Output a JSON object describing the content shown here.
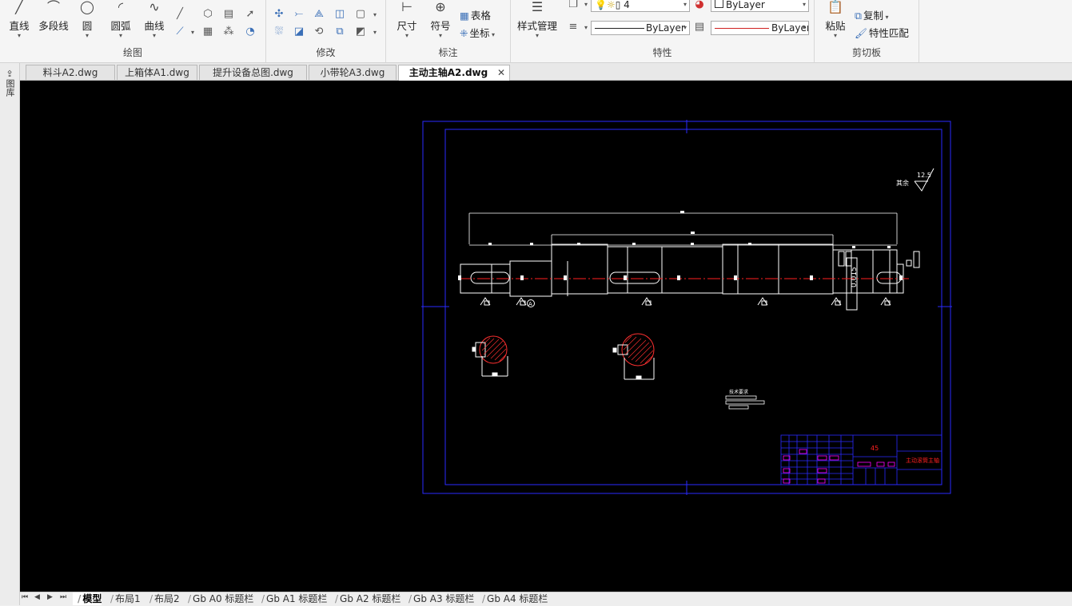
{
  "ribbon": {
    "draw": {
      "label": "绘图",
      "line": "直线",
      "polyline": "多段线",
      "circle": "圆",
      "arc": "圆弧",
      "curve": "曲线"
    },
    "modify": {
      "label": "修改"
    },
    "annotate": {
      "label": "标注",
      "dimension": "尺寸",
      "symbol": "符号",
      "table": "表格",
      "coord": "坐标"
    },
    "properties": {
      "label": "特性",
      "style_mgr": "样式管理",
      "layer_value": "4",
      "color_value": "ByLayer",
      "linetype_value": "ByLayer",
      "lineweight_value": "ByLayer"
    },
    "clipboard": {
      "label": "剪切板",
      "paste": "粘贴",
      "copy": "复制",
      "match": "特性匹配"
    }
  },
  "doc_tabs": [
    {
      "label": "料斗A2.dwg"
    },
    {
      "label": "上箱体A1.dwg"
    },
    {
      "label": "提升设备总图.dwg"
    },
    {
      "label": "小带轮A3.dwg"
    },
    {
      "label": "主动主轴A2.dwg",
      "active": true
    }
  ],
  "left_panel": {
    "label": "图库"
  },
  "drawing": {
    "roughness": "12.5",
    "roughness_note": "其余",
    "geom_tol": "0.015",
    "datum": "A",
    "notes_title": "技术要求",
    "title_material": "45",
    "title_name": "主动滚筒主轴"
  },
  "layout_tabs": [
    {
      "label": "模型",
      "active": true
    },
    {
      "label": "布局1"
    },
    {
      "label": "布局2"
    },
    {
      "label": "Gb A0 标题栏"
    },
    {
      "label": "Gb A1 标题栏"
    },
    {
      "label": "Gb A2 标题栏"
    },
    {
      "label": "Gb A3 标题栏"
    },
    {
      "label": "Gb A4 标题栏"
    }
  ],
  "colors": {
    "canvas": "#000000",
    "border": "#2a2aff",
    "entity": "#ffffff",
    "center": "#ff2020",
    "hatch": "#ff3030",
    "magenta": "#ff00ff"
  }
}
